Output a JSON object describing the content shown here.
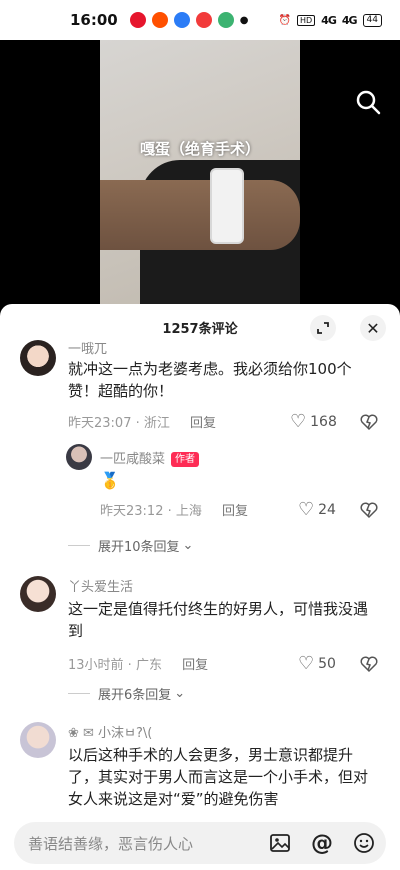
{
  "status_bar": {
    "time": "16:00",
    "app_icons": [
      "weibo-icon",
      "taobao-icon",
      "k-app-icon",
      "toutiao-icon",
      "wechat-icon"
    ],
    "signal_1": "4G",
    "signal_2": "4G",
    "battery": "44"
  },
  "video": {
    "caption": "嘎蛋（绝育手术）"
  },
  "comments_panel": {
    "title": "1257条评论",
    "comments": [
      {
        "username": "一哦兀",
        "text": "就冲这一点为老婆考虑。我必须给你100个赞！超酷的你！",
        "time_location": "昨天23:07 · 浙江",
        "reply_label": "回复",
        "likes": "168"
      },
      {
        "username": "一匹咸酸菜",
        "badge": "作者",
        "emoji": "🥇",
        "time_location": "昨天23:12 · 上海",
        "reply_label": "回复",
        "likes": "24"
      },
      {
        "username": "丫头爱生活",
        "text": "这一定是值得托付终生的好男人，可惜我没遇到",
        "time_location": "13小时前 · 广东",
        "reply_label": "回复",
        "likes": "50"
      },
      {
        "username": "❀ ✉ 小沫ㅂ?\\(",
        "text": "以后这种手术的人会更多，男士意识都提升了，其实对于男人而言这是一个小手术，但对女人来说这是对“爱”的避免伤害"
      }
    ],
    "expand_1": "展开10条回复",
    "expand_2": "展开6条回复"
  },
  "input_bar": {
    "placeholder": "善语结善缘，恶言伤人心"
  },
  "colors": {
    "accent": "#fe2c55",
    "sheet_bg": "#ffffff",
    "input_bg": "#f1f1f1"
  }
}
